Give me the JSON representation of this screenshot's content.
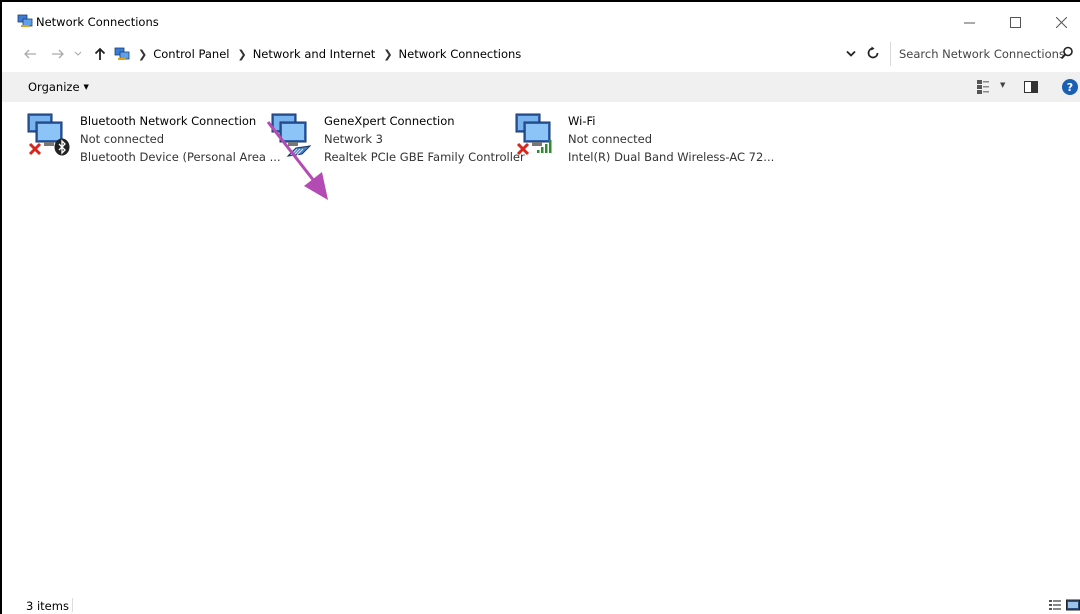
{
  "window": {
    "title": "Network Connections"
  },
  "address": {
    "crumbs": [
      "Control Panel",
      "Network and Internet",
      "Network Connections"
    ],
    "search_placeholder": "Search Network Connections"
  },
  "toolbar": {
    "organize_label": "Organize"
  },
  "items": [
    {
      "name": "Bluetooth Network Connection",
      "status": "Not connected",
      "device": "Bluetooth Device (Personal Area ...",
      "icon": "bluetooth-network-icon",
      "overlay": "disconnected-x-icon"
    },
    {
      "name": "GeneXpert Connection",
      "status": "Network  3",
      "device": "Realtek PCIe GBE Family Controller",
      "icon": "ethernet-network-icon",
      "overlay": "ethernet-cable-icon"
    },
    {
      "name": "Wi-Fi",
      "status": "Not connected",
      "device": "Intel(R) Dual Band Wireless-AC 72...",
      "icon": "wifi-network-icon",
      "overlay": "disconnected-x-icon"
    }
  ],
  "status_bar": {
    "count_text": "3 items"
  },
  "colors": {
    "annotation_arrow": "#b44bb4",
    "toolbar_bg": "#f0f0f0",
    "help_blue": "#1a5fb4",
    "disconnected_red": "#d7261e",
    "signal_green": "#2e8b2e"
  }
}
